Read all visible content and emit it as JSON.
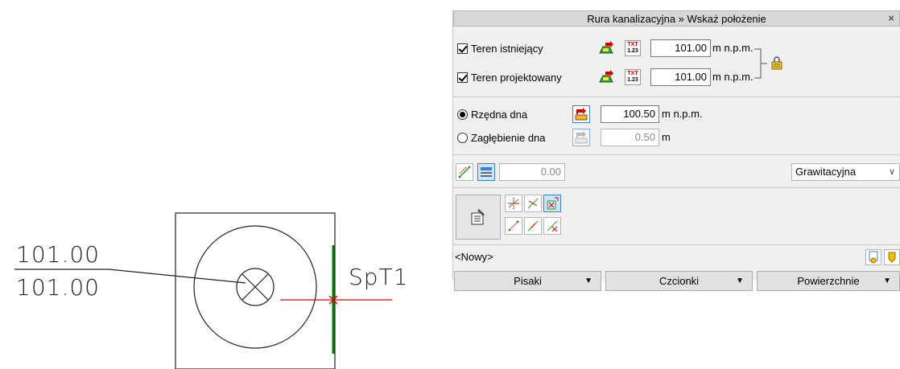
{
  "cad": {
    "label_top": "101.00",
    "label_bottom": "101.00",
    "node_name": "SpT1",
    "colors": {
      "pipe": "#e00000",
      "edge": "#008000",
      "stroke": "#222222"
    }
  },
  "dialog": {
    "title": "Rura kanalizacyjna » Wskaż położenie",
    "close_glyph": "×",
    "terrain": {
      "existing": {
        "label": "Teren istniejący",
        "checked": true,
        "value": "101.00",
        "unit": "m n.p.m."
      },
      "designed": {
        "label": "Teren projektowany",
        "checked": true,
        "value": "101.00",
        "unit": "m n.p.m."
      },
      "txt_icon_top": "TXT",
      "txt_icon_bottom": "1.23"
    },
    "bottom": {
      "invert": {
        "label": "Rzędna dna",
        "selected": true,
        "value": "100.50",
        "unit": "m n.p.m."
      },
      "depth": {
        "label": "Zagłębienie dna",
        "selected": false,
        "value": "0.50",
        "unit": "m"
      }
    },
    "slope_value": "0.00",
    "flow_type": "Grawitacyjna",
    "style_name": "<Nowy>",
    "tabs": {
      "pens": "Pisaki",
      "fonts": "Czcionki",
      "surfaces": "Powierzchnie"
    }
  }
}
